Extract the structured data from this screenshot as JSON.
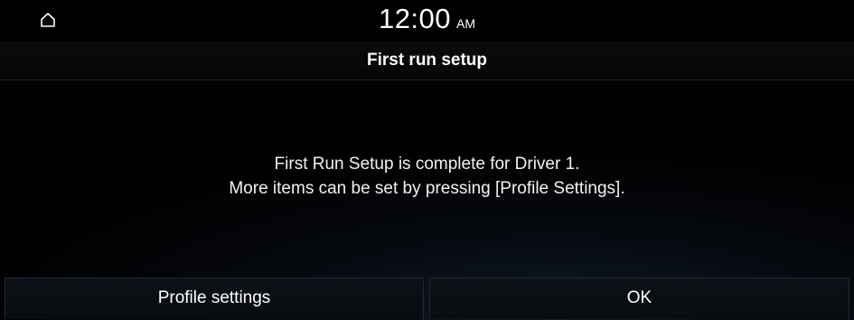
{
  "status_bar": {
    "home_icon": "home-icon",
    "time": "12:00",
    "ampm": "AM"
  },
  "header": {
    "title": "First run setup"
  },
  "message": {
    "line1": "First Run Setup is complete for Driver 1.",
    "line2": "More items can be set by pressing [Profile Settings]."
  },
  "buttons": {
    "profile_settings": "Profile settings",
    "ok": "OK"
  }
}
